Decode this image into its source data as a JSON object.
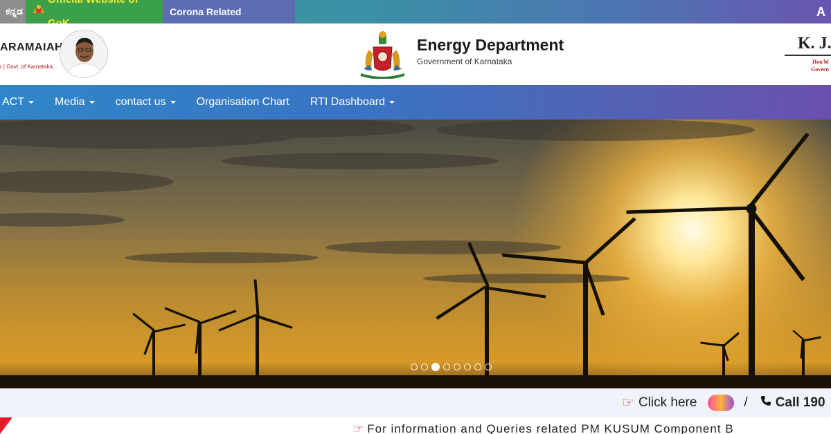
{
  "topbar": {
    "kannada_label": "ಕನ್ನಡ",
    "gok_label": "Official Website of GoK",
    "corona_label": "Corona Related Information",
    "a_label": "A"
  },
  "header": {
    "cm_name": "ARAMAIAH",
    "cm_subtitle": "r | Govt. of Karnataka.",
    "dept_title": "Energy Department",
    "dept_subtitle": "Government of Karnataka",
    "minister_name": "K. J.",
    "minister_sub1": "Hon'bl",
    "minister_sub2": "Govern"
  },
  "nav": {
    "items": [
      {
        "label": "ACT",
        "dropdown": true
      },
      {
        "label": "Media",
        "dropdown": true
      },
      {
        "label": "contact us",
        "dropdown": true
      },
      {
        "label": "Organisation Chart",
        "dropdown": false
      },
      {
        "label": "RTI Dashboard",
        "dropdown": true
      }
    ]
  },
  "carousel": {
    "slide_count": 8,
    "active_index": 2
  },
  "infobar": {
    "click_label": "Click here",
    "separator": "/",
    "call_label": "Call 190"
  },
  "ticker": {
    "text": "For information and Queries related PM KUSUM Component B"
  },
  "colors": {
    "gok_bg": "#3aa04a",
    "gok_text": "#f1ef32",
    "corona_bg": "#5d6db1",
    "accent_red": "#e21d2b"
  }
}
